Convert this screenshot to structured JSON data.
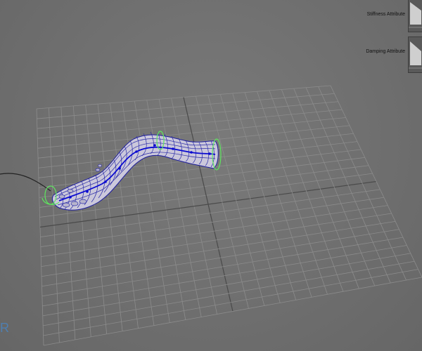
{
  "attribute_panel": {
    "stiffness_label": "Stiffness Attribute",
    "damping_label": "Damping Attribute"
  },
  "viewport": {
    "corner_letter": "R",
    "colors": {
      "background": "#6f6f6f",
      "grid_line": "#8a8a8a",
      "grid_center": "#4a4a4a",
      "mesh_fill": "#c9c6d9",
      "mesh_wire": "#1b1b9a",
      "controls": "#55e155",
      "curve": "#222222"
    }
  }
}
